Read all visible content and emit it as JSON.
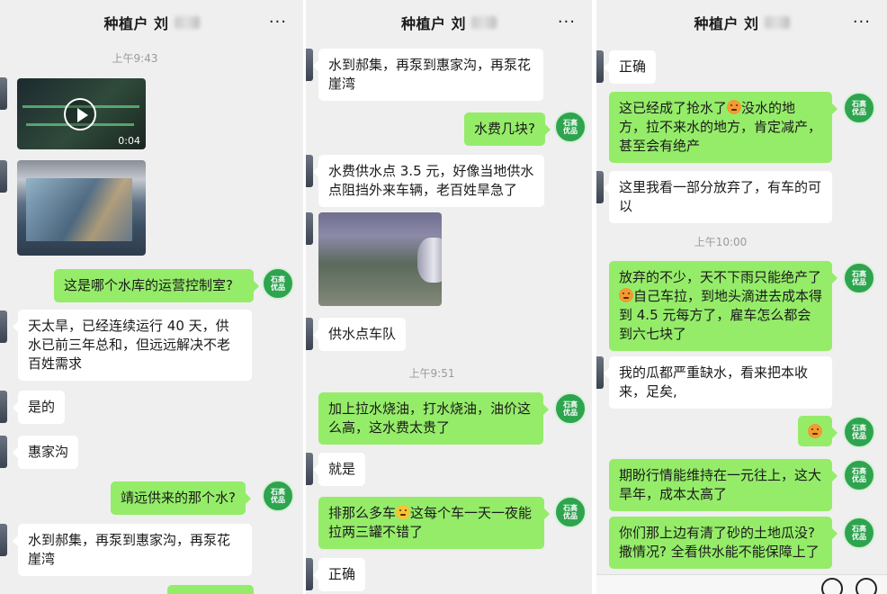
{
  "colors": {
    "bg": "#efefef",
    "incoming": "#ffffff",
    "outgoing": "#95ec69",
    "avatar": "#2ea44f"
  },
  "avatar_icon": "green-logo-avatar",
  "avatar_text": "石高优品",
  "panels": [
    {
      "title": "种植户 刘",
      "more": "···",
      "timestamp": "上午9:43",
      "video_duration": "0:04",
      "messages": [
        "这是哪个水库的运营控制室?",
        "天太旱，已经连续运行 40 天，供水已前三年总和，但远远解决不老百姓需求",
        "是的",
        "惠家沟",
        "靖远供来的那个水?",
        "水到郝集，再泵到惠家沟，再泵花崖湾"
      ]
    },
    {
      "title": "种植户 刘",
      "more": "···",
      "timestamp": "上午9:51",
      "messages": [
        "水到郝集，再泵到惠家沟，再泵花崖湾",
        "水费几块?",
        "水费供水点 3.5 元，好像当地供水点阻挡外来车辆，老百姓旱急了",
        "供水点车队",
        "加上拉水烧油，打水烧油，油价这么高，这水费太贵了",
        "就是",
        "排那么多车",
        "这每个车一天一夜能拉两三罐不错了",
        "正确"
      ]
    },
    {
      "title": "种植户 刘",
      "more": "···",
      "timestamp": "上午10:00",
      "messages": [
        "正确",
        "这已经成了抢水了",
        "没水的地方，拉不来水的地方，肯定减产，甚至会有绝产",
        "这里我看一部分放弃了，有车的可以",
        "放弃的不少，天不下雨只能绝产了",
        "自己车拉，到地头滴进去成本得到 4.5 元每方了，雇车怎么都会到六七块了",
        "我的瓜都严重缺水，看来把本收来，足矣,",
        "期盼行情能维持在一元往上，这大旱年，成本太高了",
        "你们那上边有清了砂的土地瓜没?撒情况? 全看供水能不能保障上了"
      ]
    }
  ]
}
